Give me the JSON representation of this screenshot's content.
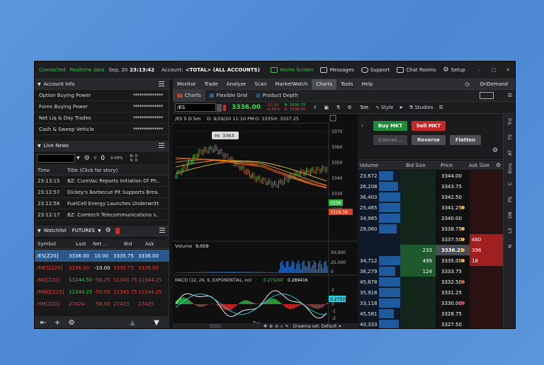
{
  "topbar": {
    "status_connected": "Connected",
    "status_realtime": "Realtime data",
    "date": "Sep, 20",
    "time": "23:13:42",
    "account_label": "Account:",
    "account_value": "<TOTAL> (ALL ACCOUNTS)",
    "home": "Home Screen",
    "messages": "Messages",
    "support": "Support",
    "chatrooms": "Chat Rooms",
    "setup": "Setup"
  },
  "account_info": {
    "title": "Account Info",
    "rows": [
      {
        "label": "Option Buying Power",
        "value": "**************"
      },
      {
        "label": "Forex Buying Power",
        "value": "**************"
      },
      {
        "label": "Net Liq & Day Trades",
        "value": "**************"
      },
      {
        "label": "Cash & Sweep Vehicle",
        "value": "**************"
      }
    ]
  },
  "live_news": {
    "title": "Live News",
    "counter_a": "0",
    "counter_b": "0",
    "pct": "0.00%",
    "r_label": "R: 0",
    "s_label": "S: 0",
    "col_time": "Time",
    "col_title": "Title (Click for story)",
    "items": [
      {
        "time": "23:13:15",
        "title": "BZ: CureVac Reports Initiation Of Ph..."
      },
      {
        "time": "23:12:57",
        "title": "Dickey's Barbecue Pit Supports Brea..."
      },
      {
        "time": "23:12:56",
        "title": "FuelCell Energy Launches Underwritt..."
      },
      {
        "time": "23:12:17",
        "title": "BZ: Comtech Telecommunications s..."
      }
    ]
  },
  "watchlist": {
    "title": "Watchlist",
    "list": "FUTURES",
    "columns": [
      "Symbol",
      "Last",
      "Net ...",
      "Bid",
      "Ask"
    ],
    "rows": [
      {
        "symbol": "/ES[Z20]",
        "last": "3336.00",
        "net": "10.00",
        "bid": "3335.75",
        "ask": "3336.00",
        "color": "#ffffff",
        "netcolor": "#ffffff"
      },
      {
        "symbol": "/MES[Z20]",
        "last": "3336.00",
        "net": "-10.00",
        "bid": "3335.75",
        "ask": "3336.00",
        "color": "#e04040",
        "netcolor": "#ffffff"
      },
      {
        "symbol": "/NQ[Z20]",
        "last": "11244.50",
        "net": "-50.25",
        "bid": "11343.75",
        "ask": "11344.25",
        "color": "#e04040",
        "netcolor": "#3fbf4f"
      },
      {
        "symbol": "/MNQ[Z20]",
        "last": "11344.25",
        "net": "-50.50",
        "bid": "11343.75",
        "ask": "11344.25",
        "color": "#e04040",
        "netcolor": "#e04040"
      },
      {
        "symbol": "/YM[Z20]",
        "last": "27424",
        "net": "-58.00",
        "bid": "27423",
        "ask": "27425",
        "color": "#e04040",
        "netcolor": "#e04040"
      }
    ]
  },
  "menu": [
    "Monitor",
    "Trade",
    "Analyze",
    "Scan",
    "MarketWatch",
    "Charts",
    "Tools",
    "Help"
  ],
  "ondemand": "OnDemand",
  "subtabs": {
    "charts": "Charts",
    "grid": "Flexible Grid",
    "depth": "Product Depth"
  },
  "chart": {
    "symbol": "/ES",
    "last_price": "3336.00",
    "change": "-10.00",
    "change_pct": "-0.30%",
    "bid_label": "B: 3335.75",
    "ask_label": "A: 3336.00",
    "timeframe": "5m",
    "style": "Style",
    "studies": "Studies",
    "info_line": "/ES 5 D 5m",
    "info_date": "D: 9/29/20 11:10 PM",
    "info_o": "O: 3335",
    "info_h": "H: 3337.25",
    "hi_label": "Hi: 3363",
    "price_ticks": [
      "3370",
      "3360",
      "3350",
      "3340",
      "3330",
      "3320"
    ],
    "price_tag": "3336",
    "price_tag2": "3329.39",
    "volume_label": "Volume",
    "volume_value": "9,059",
    "vol_ticks": [
      "50,000",
      "25,000",
      "0"
    ],
    "macd_label": "MACD (12, 26, 9, EXPONENTIAL, no)",
    "macd_v1": "0.275297",
    "macd_v2": "0.289416",
    "macd_ticks": [
      "2",
      "1",
      "0",
      "-1",
      "-2",
      "-3",
      "-4"
    ],
    "macd_tag": "0.2753",
    "x_label": "Tue",
    "drawing_set": "Drawing set: Default"
  },
  "trade": {
    "buy": "Buy MKT",
    "sell": "Sell MKT",
    "cancel": "Cancel...",
    "reverse": "Reverse",
    "flatten": "Flatten",
    "columns": [
      "Volume",
      "Bid Size",
      "Price",
      "Ask Size"
    ],
    "ladder": [
      {
        "vol": "23,672",
        "bid": "",
        "price": "3344.00",
        "ask": "",
        "dot": ""
      },
      {
        "vol": "26,208",
        "bid": "",
        "price": "3343.75",
        "ask": "",
        "dot": ""
      },
      {
        "vol": "36,403",
        "bid": "",
        "price": "3342.50",
        "ask": "",
        "dot": ""
      },
      {
        "vol": "25,465",
        "bid": "",
        "price": "3341.25",
        "ask": "",
        "dot": "#f0b030"
      },
      {
        "vol": "34,965",
        "bid": "",
        "price": "3340.00",
        "ask": "",
        "dot": ""
      },
      {
        "vol": "29,060",
        "bid": "",
        "price": "3338.75",
        "ask": "",
        "dot": "#f0b030"
      },
      {
        "vol": "",
        "bid": "",
        "price": "3337.50",
        "ask": "460",
        "dot": "#f0b030"
      },
      {
        "vol": "",
        "bid": "233",
        "price": "3336.25",
        "ask": "396",
        "dot": "#f0b030"
      },
      {
        "vol": "34,712",
        "bid": "499",
        "price": "3335.00",
        "ask": "18",
        "dot": "#f0b030"
      },
      {
        "vol": "36,279",
        "bid": "124",
        "price": "3333.75",
        "ask": "",
        "dot": ""
      },
      {
        "vol": "45,878",
        "bid": "",
        "price": "3332.50",
        "ask": "",
        "dot": "#e06030"
      },
      {
        "vol": "35,918",
        "bid": "",
        "price": "3331.25",
        "ask": "",
        "dot": ""
      },
      {
        "vol": "33,118",
        "bid": "",
        "price": "3330.00",
        "ask": "",
        "dot": "#e04040"
      },
      {
        "vol": "45,581",
        "bid": "",
        "price": "3328.75",
        "ask": "",
        "dot": ""
      },
      {
        "vol": "40,333",
        "bid": "",
        "price": "3327.50",
        "ask": "",
        "dot": ""
      }
    ],
    "vtabs": [
      "Trd",
      "TS",
      "AT",
      "Btns",
      "C",
      "PS",
      "DB",
      "L2",
      "N"
    ]
  }
}
